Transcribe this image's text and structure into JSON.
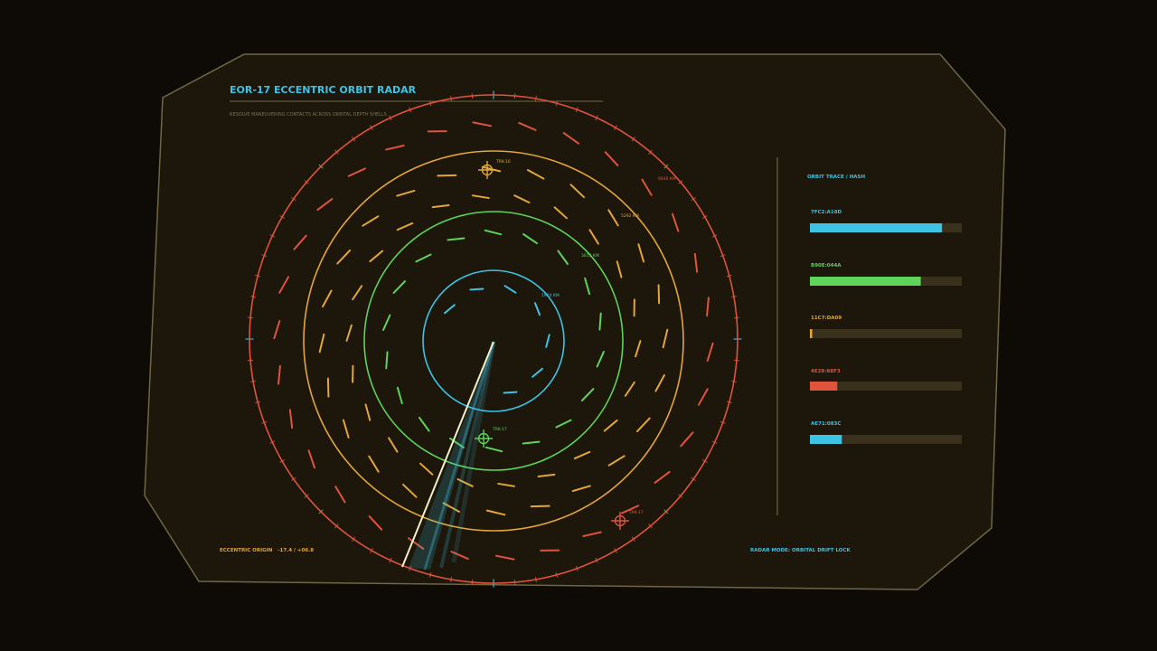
{
  "colors": {
    "background": "#0e0b06",
    "panel_fill": "#1c160b",
    "panel_stroke": "#6e6644",
    "cyan": "#3ec3e4",
    "green": "#5fd35a",
    "amber": "#e3a63a",
    "red": "#e0543e",
    "muted": "#7d735a",
    "bar_track": "#3a311c",
    "sweep": "#f3efc9"
  },
  "header": {
    "title": "EOR-17  ECCENTRIC ORBIT RADAR",
    "subtitle": "RESOLVE MANEUVERING CONTACTS ACROSS ORBITAL DEPTH SHELLS"
  },
  "radar": {
    "shells": [
      {
        "label": "1974 KM",
        "color": "#3ec3e4"
      },
      {
        "label": "3613 KM",
        "color": "#5fd35a"
      },
      {
        "label": "5292 KM",
        "color": "#e3a63a"
      },
      {
        "label": "6846 KM",
        "color": "#e0543e"
      }
    ],
    "tracks": [
      {
        "label": "TRK-16",
        "color": "#e3a63a"
      },
      {
        "label": "TRK-17",
        "color": "#5fd35a"
      },
      {
        "label": "TRK-17",
        "color": "#e0543e"
      }
    ],
    "origin_label": "ECCENTRIC ORIGIN",
    "origin_value": "-17.4 / +06.8",
    "mode_label": "RADAR MODE: ORBITAL DRIFT LOCK"
  },
  "sidebar": {
    "title": "ORBIT TRACE / HASH",
    "items": [
      {
        "hash": "7FC2:A18D",
        "color": "#3ec3e4",
        "fill": 0.87
      },
      {
        "hash": "B90E:044A",
        "color": "#5fd35a",
        "fill": 0.73
      },
      {
        "hash": "11C7:DA09",
        "color": "#e3a63a",
        "fill": 0.015
      },
      {
        "hash": "4E28:88F3",
        "color": "#e0543e",
        "fill": 0.18
      },
      {
        "hash": "AE71:083C",
        "color": "#3ec3e4",
        "fill": 0.21
      }
    ]
  }
}
